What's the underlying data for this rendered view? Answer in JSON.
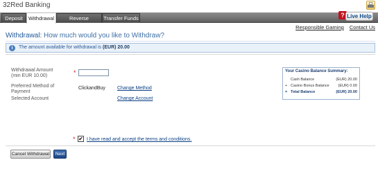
{
  "app": {
    "title": "32Red Banking"
  },
  "tabs": [
    {
      "label": "Deposit",
      "active": false
    },
    {
      "label": "Withdrawal",
      "active": true
    },
    {
      "label": "Reverse Withdrawal",
      "active": false
    },
    {
      "label": "Transfer Funds",
      "active": false
    }
  ],
  "help": {
    "label": "Live Help"
  },
  "links": {
    "responsible_gaming": "Responsible Gaming",
    "contact_us": "Contact Us"
  },
  "heading": {
    "prefix": "Withdrawal:",
    "text": "How much would you like to Withdraw?"
  },
  "notice": {
    "text": "The amount available for withdrawal is",
    "amount": "(EUR) 20.00"
  },
  "form": {
    "amount_label_line1": "Withdrawal Amount",
    "amount_label_line2": "(min EUR 10.00)",
    "amount_value": "",
    "method_label_line1": "Preferred Method of",
    "method_label_line2": "Payment",
    "method_value": "ClickandBuy",
    "change_method": "Change Method",
    "account_label": "Selected Account",
    "change_account": "Change Account",
    "required_marker": "*"
  },
  "summary": {
    "title": "Your Casino Balance Summary:",
    "rows": [
      {
        "prefix": "",
        "label": "Cash Balance",
        "amount": "(EUR) 20.00"
      },
      {
        "prefix": "+",
        "label": "Casino Bonus Balance",
        "amount": "(EUR) 0.00"
      },
      {
        "prefix": "=",
        "label": "Total Balance",
        "amount": "(EUR) 20.00"
      }
    ]
  },
  "terms": {
    "checked": true,
    "check_mark": "✔",
    "label": "I have read and accept the terms and conditions."
  },
  "buttons": {
    "cancel": "Cancel Withdrawal",
    "next": "Next"
  },
  "colors": {
    "accent": "#225a9a",
    "brand_red": "#c1121f",
    "required": "#d41c1c"
  }
}
